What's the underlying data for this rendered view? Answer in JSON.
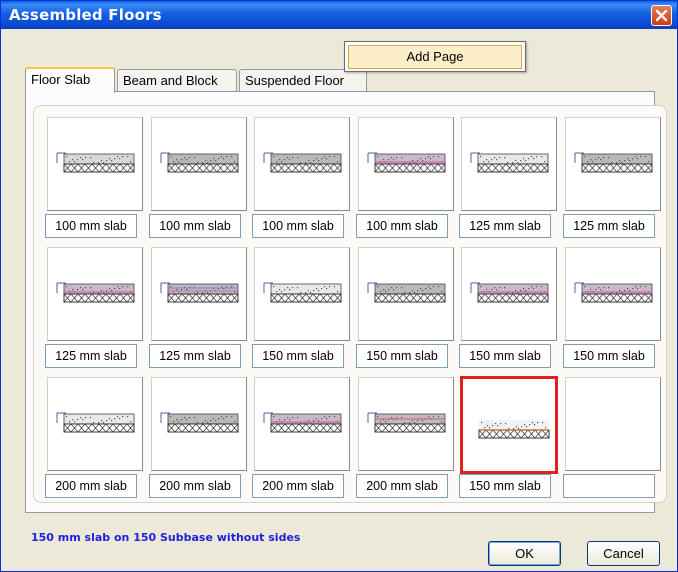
{
  "window": {
    "title": "Assembled Floors"
  },
  "tabs": [
    {
      "label": "Floor Slab",
      "active": true
    },
    {
      "label": "Beam and Block",
      "active": false
    },
    {
      "label": "Suspended Floor",
      "active": false
    }
  ],
  "popup": {
    "item": "Add Page"
  },
  "grid": [
    {
      "caption": "100 mm slab",
      "variant": "flat"
    },
    {
      "caption": "100 mm slab",
      "variant": "heavy"
    },
    {
      "caption": "100 mm slab",
      "variant": "heavy"
    },
    {
      "caption": "100 mm slab",
      "variant": "pink"
    },
    {
      "caption": "125 mm slab",
      "variant": "light"
    },
    {
      "caption": "125 mm slab",
      "variant": "heavy"
    },
    {
      "caption": "125 mm slab",
      "variant": "pink"
    },
    {
      "caption": "125 mm slab",
      "variant": "layered"
    },
    {
      "caption": "150 mm slab",
      "variant": "light"
    },
    {
      "caption": "150 mm slab",
      "variant": "heavy"
    },
    {
      "caption": "150 mm slab",
      "variant": "pink"
    },
    {
      "caption": "150 mm slab",
      "variant": "pink"
    },
    {
      "caption": "200 mm slab",
      "variant": "light"
    },
    {
      "caption": "200 mm slab",
      "variant": "heavy"
    },
    {
      "caption": "200 mm slab",
      "variant": "pink"
    },
    {
      "caption": "200 mm slab",
      "variant": "pinkmid"
    },
    {
      "caption": "150 mm slab",
      "variant": "nosides",
      "selected": true
    },
    {
      "caption": "",
      "variant": "empty"
    }
  ],
  "status_text": "150 mm slab on 150 Subbase without sides",
  "buttons": {
    "ok": "OK",
    "cancel": "Cancel"
  },
  "colors": {
    "selection": "#e0201f",
    "title_bar": "#1560e6",
    "status_text": "#2020e0"
  }
}
